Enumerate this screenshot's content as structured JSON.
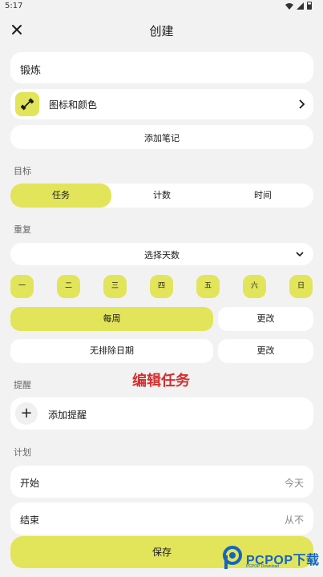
{
  "status_bar": {
    "time": "5:17"
  },
  "header": {
    "title": "创建"
  },
  "name_field": {
    "value": "锻炼"
  },
  "icon_color": {
    "label": "图标和颜色"
  },
  "add_note": {
    "label": "添加笔记"
  },
  "goal": {
    "section_label": "目标",
    "options": [
      "任务",
      "计数",
      "时间"
    ],
    "selected": "任务"
  },
  "repeat": {
    "section_label": "重复",
    "dropdown_label": "选择天数",
    "days": [
      "一",
      "二",
      "三",
      "四",
      "五",
      "六",
      "日"
    ],
    "frequency_label": "每周",
    "frequency_change": "更改",
    "exclusion_label": "无排除日期",
    "exclusion_change": "更改"
  },
  "overlay_caption": "编辑任务",
  "reminder": {
    "section_label": "提醒",
    "add_label": "添加提醒"
  },
  "plan": {
    "section_label": "计划",
    "start_label": "开始",
    "start_value": "今天",
    "end_label": "结束",
    "end_value": "从不"
  },
  "save_label": "保存",
  "watermark": {
    "text": "PCPOP下载",
    "subtext": "PCPOP Download"
  },
  "colors": {
    "accent": "#e2e45a",
    "background": "#f2f2f2",
    "card": "#ffffff",
    "watermark_red": "#d32f2f",
    "logo_blue": "#1565c0"
  },
  "icons": {
    "close": "close-icon",
    "dumbbell": "dumbbell-icon",
    "chevron_right": "chevron-right-icon",
    "chevron_down": "chevron-down-icon",
    "plus": "plus-icon"
  }
}
